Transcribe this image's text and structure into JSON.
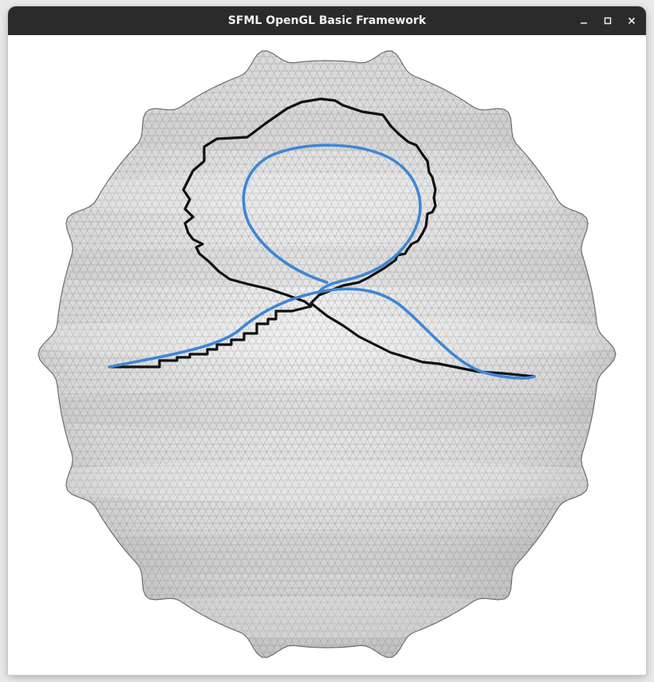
{
  "window": {
    "title": "SFML OpenGL Basic Framework",
    "controls": {
      "minimize": "minimize-icon",
      "maximize": "maximize-icon",
      "close": "close-icon"
    }
  },
  "scene": {
    "background_color": "#ffffff",
    "mesh_fill_color": "#dcdcdc",
    "mesh_line_color": "#8a8a8a",
    "curves": [
      {
        "name": "black-path",
        "color": "#111111"
      },
      {
        "name": "blue-path",
        "color": "#3f86d6"
      }
    ]
  }
}
